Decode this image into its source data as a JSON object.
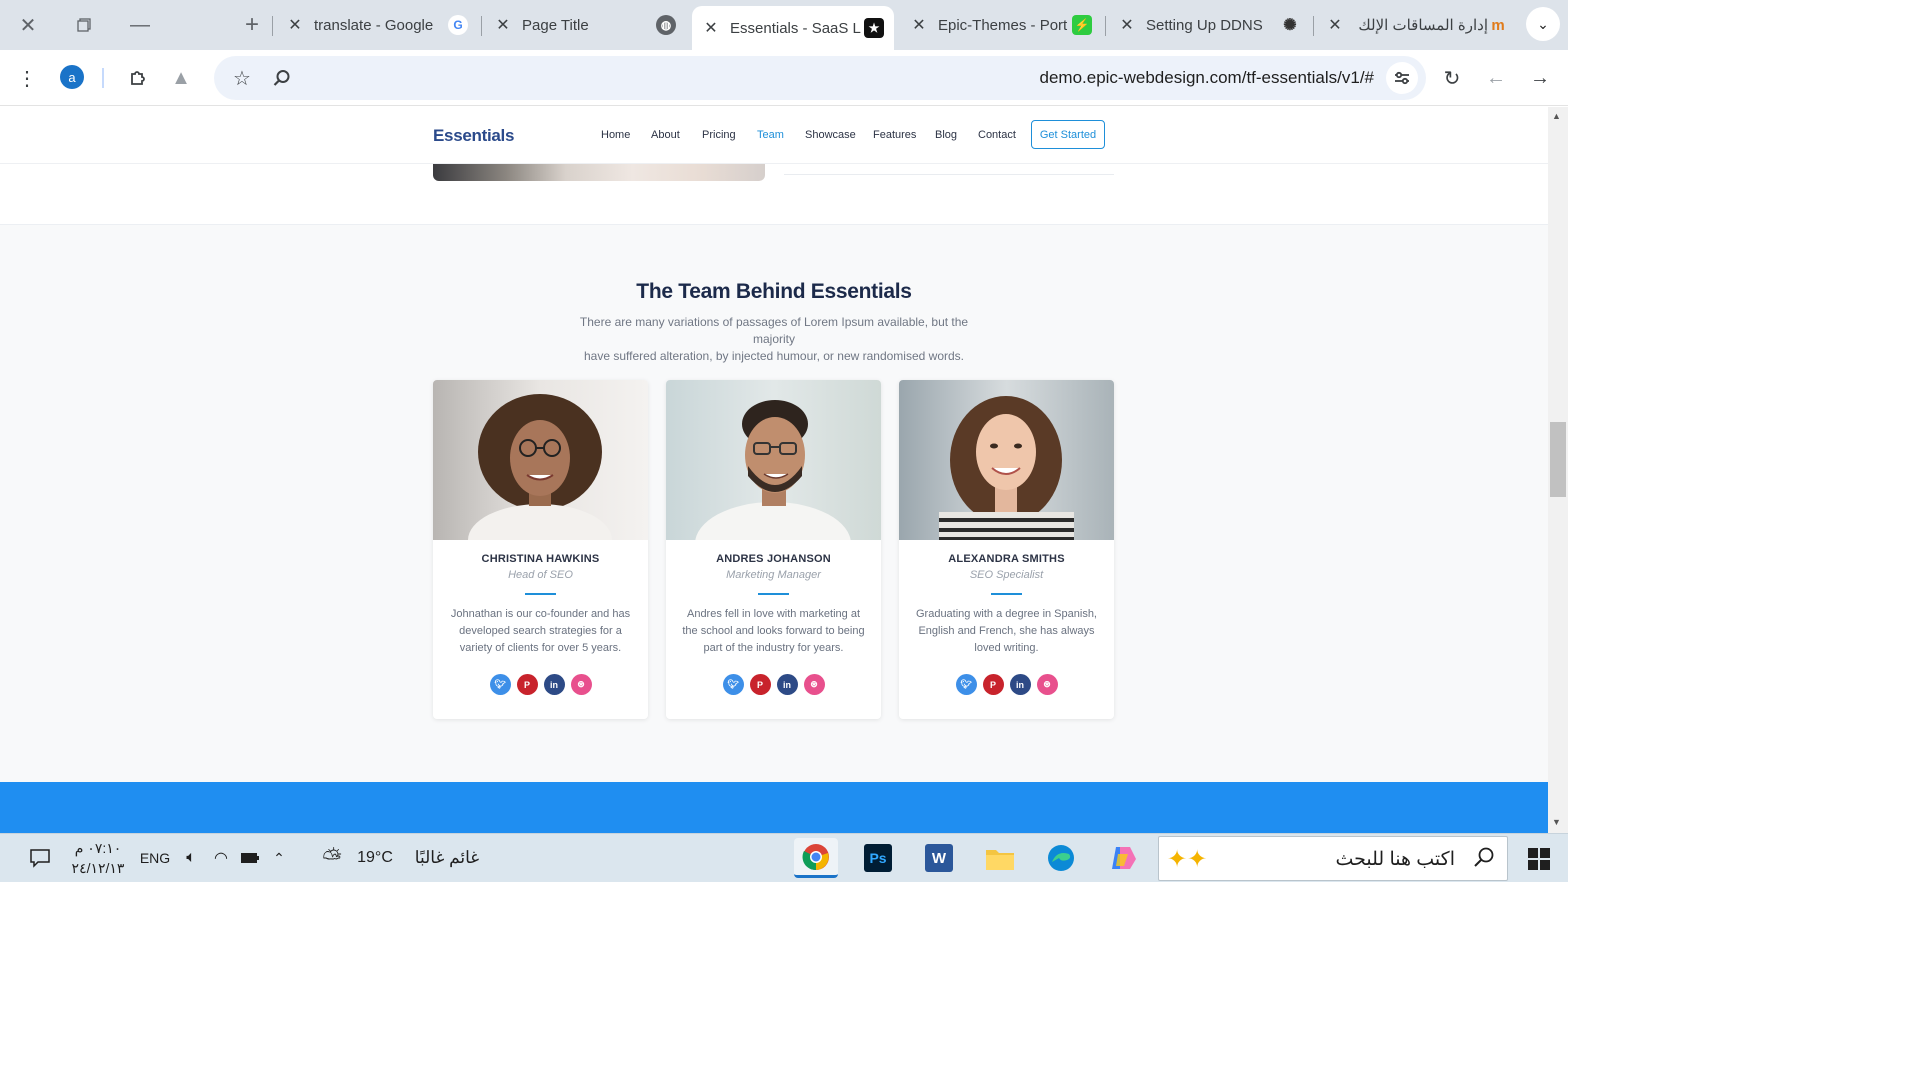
{
  "browser": {
    "tabs": [
      {
        "title": "translate - Google",
        "favicon": "G",
        "active": false
      },
      {
        "title": "Page Title",
        "favicon": "globe",
        "active": false
      },
      {
        "title": "Essentials - SaaS L",
        "favicon": "★",
        "active": true
      },
      {
        "title": "Epic-Themes - Port",
        "favicon": "epic",
        "active": false
      },
      {
        "title": "Setting Up DDNS",
        "favicon": "openai",
        "active": false
      },
      {
        "title": "إدارة المساقات الإلك",
        "favicon": "m",
        "active": false
      }
    ],
    "profile_initial": "a",
    "url": "demo.epic-webdesign.com/tf-essentials/v1/#"
  },
  "site": {
    "brand": "Essentials",
    "nav": [
      "Home",
      "About",
      "Pricing",
      "Team",
      "Showcase",
      "Features",
      "Blog",
      "Contact"
    ],
    "active_nav": "Team",
    "cta": "Get Started"
  },
  "team": {
    "title": "The Team Behind Essentials",
    "subtitle_line1": "There are many variations of passages of Lorem Ipsum available, but the majority",
    "subtitle_line2": "have suffered alteration, by injected humour, or new randomised words.",
    "members": [
      {
        "name": "CHRISTINA HAWKINS",
        "role": "Head of SEO",
        "bio": "Johnathan is our co-founder and has developed search strategies for a variety of clients for over 5 years."
      },
      {
        "name": "ANDRES JOHANSON",
        "role": "Marketing Manager",
        "bio": "Andres fell in love with marketing at the school and looks forward to being part of the industry for years."
      },
      {
        "name": "ALEXANDRA SMITHS",
        "role": "SEO Specialist",
        "bio": "Graduating with a degree in Spanish, English and French, she has always loved writing."
      }
    ],
    "social_colors": {
      "twitter": "#3d8fe8",
      "pinterest": "#c8232c",
      "linkedin": "#2d4a86",
      "dribbble": "#e8508d"
    }
  },
  "taskbar": {
    "time": "٠٧:١٠ م",
    "date": "٢٤/١٢/١٣",
    "lang": "ENG",
    "weather_temp": "19°C",
    "weather_text": "غائم غالبًا",
    "search_placeholder": "اكتب هنا للبحث"
  }
}
